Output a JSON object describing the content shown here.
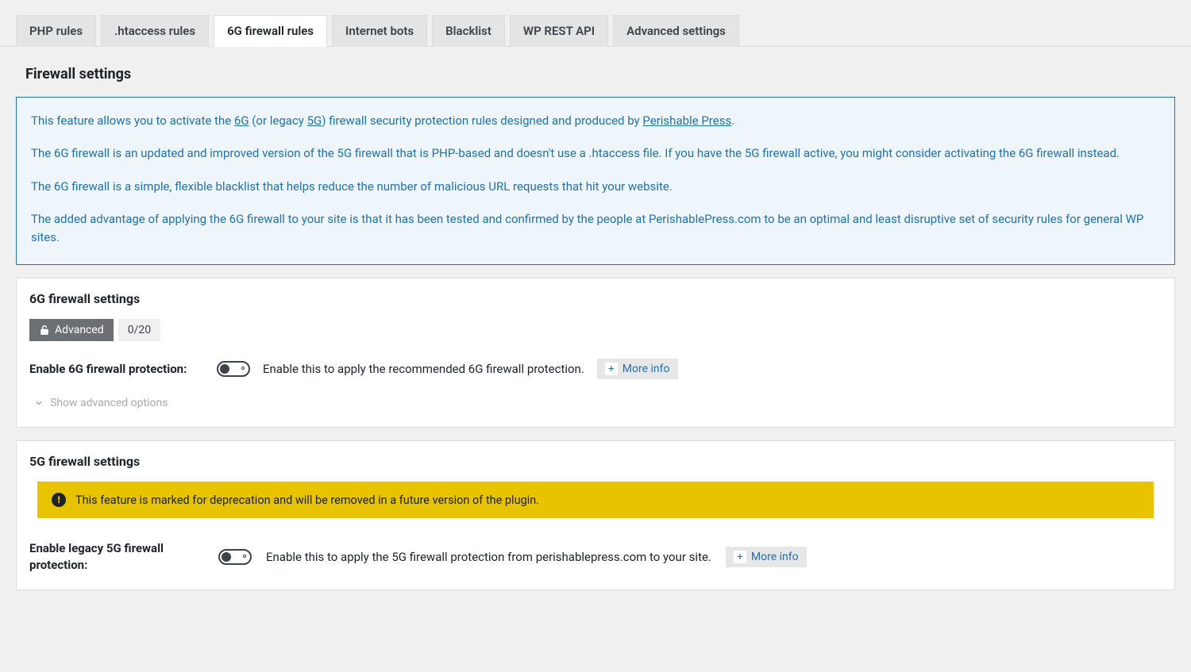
{
  "tabs": {
    "items": [
      {
        "label": "PHP rules",
        "active": false
      },
      {
        "label": ".htaccess rules",
        "active": false
      },
      {
        "label": "6G firewall rules",
        "active": true
      },
      {
        "label": "Internet bots",
        "active": false
      },
      {
        "label": "Blacklist",
        "active": false
      },
      {
        "label": "WP REST API",
        "active": false
      },
      {
        "label": "Advanced settings",
        "active": false
      }
    ]
  },
  "page_title": "Firewall settings",
  "info": {
    "p1_a": "This feature allows you to activate the ",
    "link_6g": "6G",
    "p1_b": " (or legacy ",
    "link_5g": "5G",
    "p1_c": ") firewall security protection rules designed and produced by ",
    "link_pp": "Perishable Press",
    "p1_d": ".",
    "p2": "The 6G firewall is an updated and improved version of the 5G firewall that is PHP-based and doesn't use a .htaccess file. If you have the 5G firewall active, you might consider activating the 6G firewall instead.",
    "p3": "The 6G firewall is a simple, flexible blacklist that helps reduce the number of malicious URL requests that hit your website.",
    "p4": "The added advantage of applying the 6G firewall to your site is that it has been tested and confirmed by the people at PerishablePress.com to be an optimal and least disruptive set of security rules for general WP sites."
  },
  "panel_6g": {
    "title": "6G firewall settings",
    "badge_advanced": "Advanced",
    "badge_count": "0/20",
    "setting_label": "Enable 6G firewall protection:",
    "setting_desc": "Enable this to apply the recommended 6G firewall protection.",
    "more_info": "More info",
    "show_advanced": "Show advanced options"
  },
  "panel_5g": {
    "title": "5G firewall settings",
    "warning": "This feature is marked for deprecation and will be removed in a future version of the plugin.",
    "setting_label": "Enable legacy 5G firewall protection:",
    "setting_desc": "Enable this to apply the 5G firewall protection from perishablepress.com to your site.",
    "more_info": "More info"
  }
}
